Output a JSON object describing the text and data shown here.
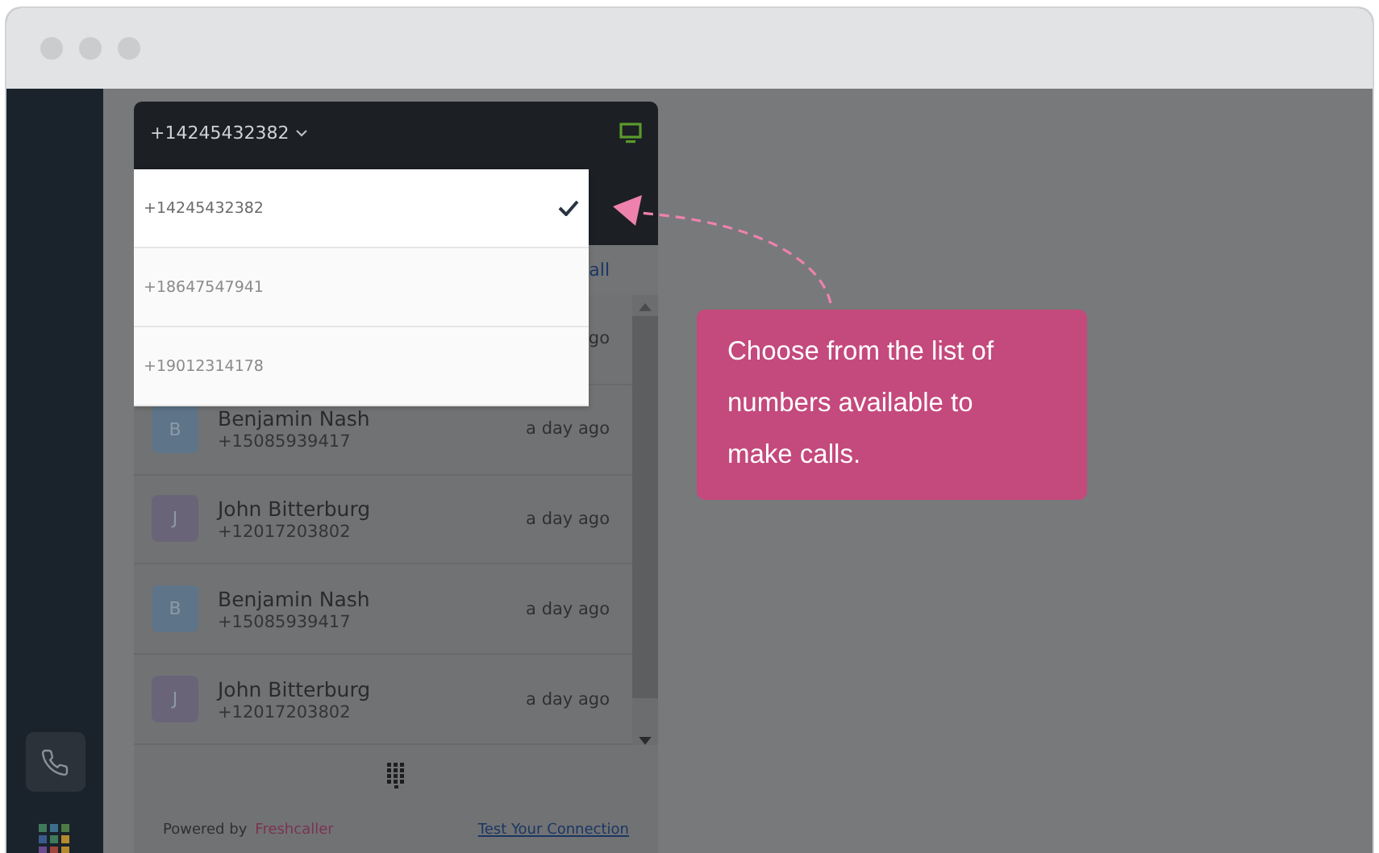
{
  "header": {
    "number": "+14245432382"
  },
  "numbers": [
    {
      "number": "+14245432382",
      "selected": true
    },
    {
      "number": "+18647547941",
      "selected": false
    },
    {
      "number": "+19012314178",
      "selected": false
    }
  ],
  "link": "all",
  "calls": [
    {
      "time": "go"
    },
    {
      "name": "Benjamin Nash",
      "initial": "B",
      "color": "#5e7488",
      "number": "+15085939417",
      "time": "a day ago"
    },
    {
      "name": "John Bitterburg",
      "initial": "J",
      "color": "#6a6479",
      "number": "+12017203802",
      "time": "a day ago"
    },
    {
      "name": "Benjamin Nash",
      "initial": "B",
      "color": "#5e7488",
      "number": "+15085939417",
      "time": "a day ago"
    },
    {
      "name": "John Bitterburg",
      "initial": "J",
      "color": "#6a6479",
      "number": "+12017203802",
      "time": "a day ago"
    }
  ],
  "footer": {
    "powered": "Powered by",
    "brand": "Freshcaller",
    "link": "Test Your Connection"
  },
  "callout": "Choose from the list of numbers available to make calls."
}
